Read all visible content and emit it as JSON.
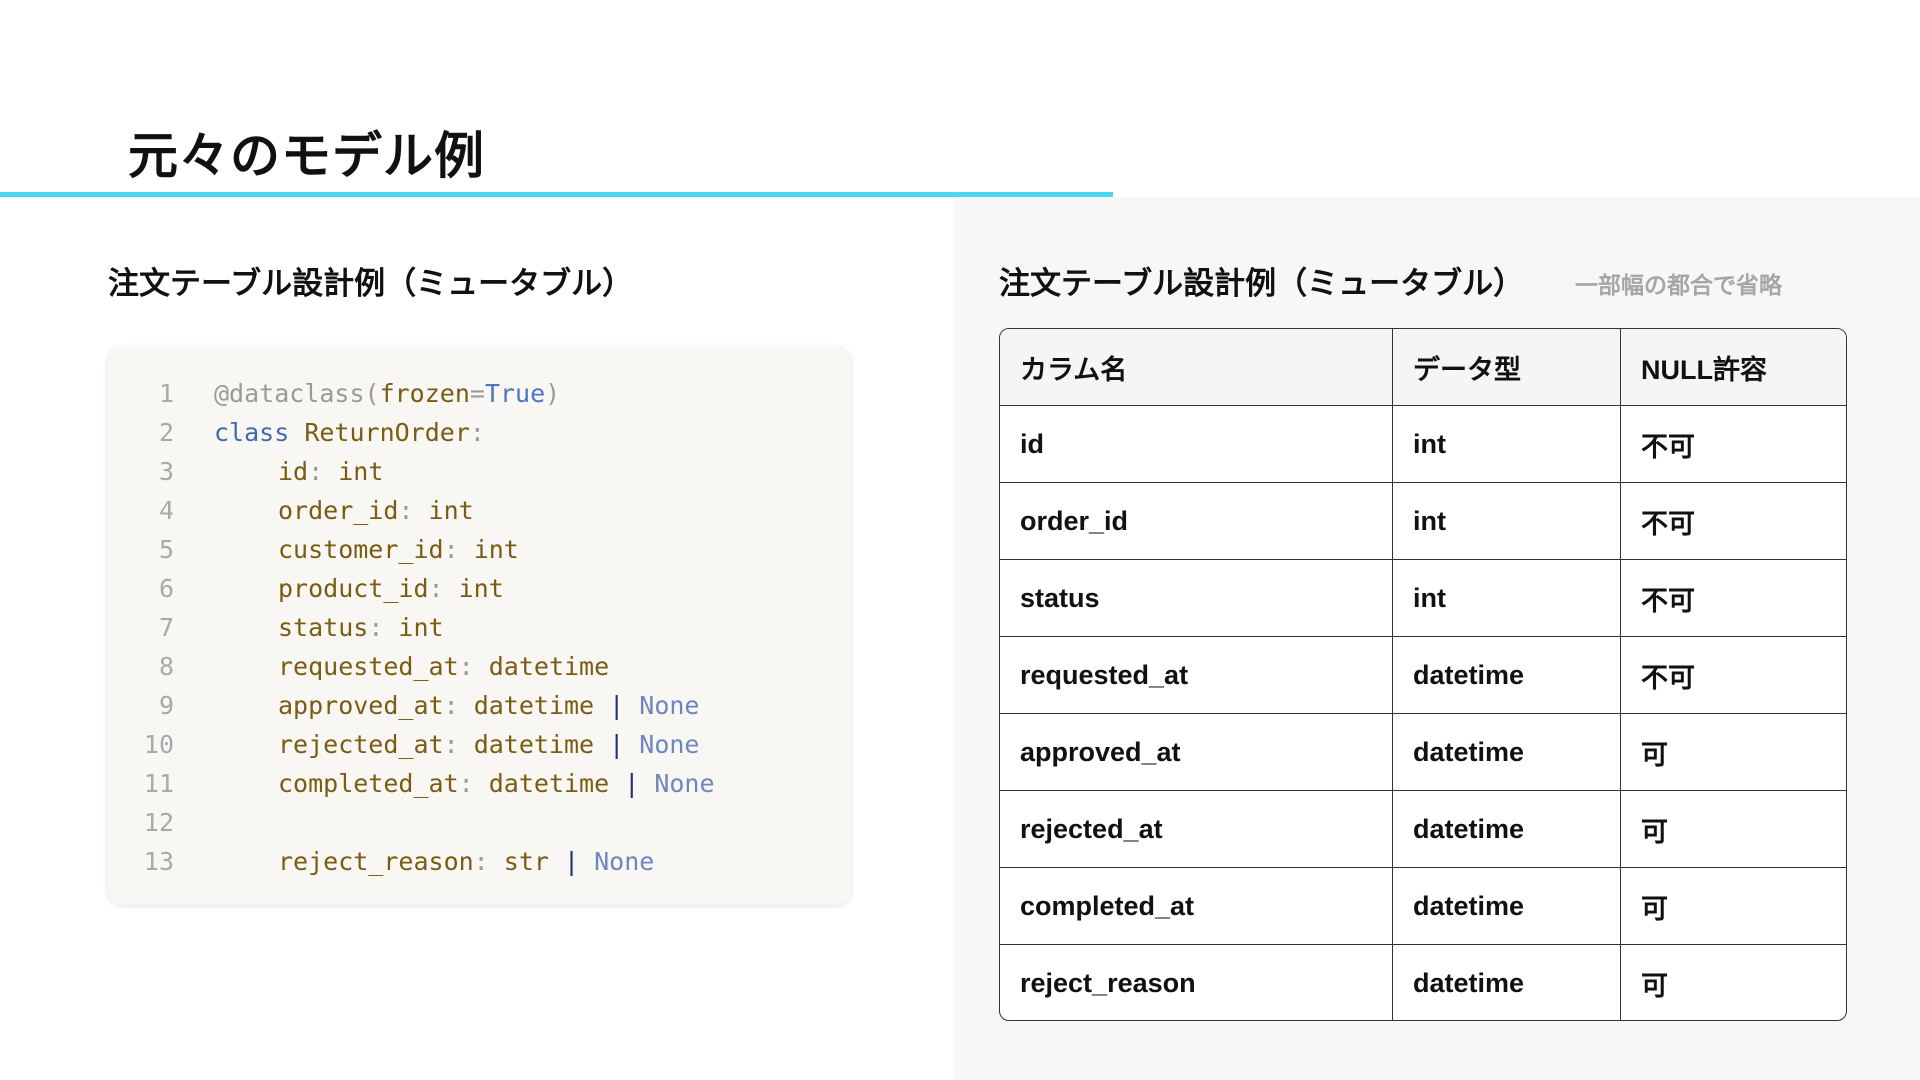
{
  "slide": {
    "title": "元々のモデル例",
    "accent_color": "#4dd6ef"
  },
  "left_section": {
    "heading": "注文テーブル設計例（ミュータブル）"
  },
  "code": {
    "lines": [
      {
        "n": "1",
        "indent": 0,
        "tokens": [
          [
            "deco",
            "@dataclass("
          ],
          [
            "name",
            "frozen"
          ],
          [
            "punct",
            "="
          ],
          [
            "true",
            "True"
          ],
          [
            "deco",
            ")"
          ]
        ]
      },
      {
        "n": "2",
        "indent": 0,
        "tokens": [
          [
            "kw",
            "class "
          ],
          [
            "name",
            "ReturnOrder"
          ],
          [
            "punct",
            ":"
          ]
        ]
      },
      {
        "n": "3",
        "indent": 1,
        "tokens": [
          [
            "name",
            "id"
          ],
          [
            "punct",
            ": "
          ],
          [
            "name",
            "int"
          ]
        ]
      },
      {
        "n": "4",
        "indent": 1,
        "tokens": [
          [
            "name",
            "order_id"
          ],
          [
            "punct",
            ": "
          ],
          [
            "name",
            "int"
          ]
        ]
      },
      {
        "n": "5",
        "indent": 1,
        "tokens": [
          [
            "name",
            "customer_id"
          ],
          [
            "punct",
            ": "
          ],
          [
            "name",
            "int"
          ]
        ]
      },
      {
        "n": "6",
        "indent": 1,
        "tokens": [
          [
            "name",
            "product_id"
          ],
          [
            "punct",
            ": "
          ],
          [
            "name",
            "int"
          ]
        ]
      },
      {
        "n": "7",
        "indent": 1,
        "tokens": [
          [
            "name",
            "status"
          ],
          [
            "punct",
            ": "
          ],
          [
            "name",
            "int"
          ]
        ]
      },
      {
        "n": "8",
        "indent": 1,
        "tokens": [
          [
            "name",
            "requested_at"
          ],
          [
            "punct",
            ": "
          ],
          [
            "name",
            "datetime"
          ]
        ]
      },
      {
        "n": "9",
        "indent": 1,
        "tokens": [
          [
            "name",
            "approved_at"
          ],
          [
            "punct",
            ": "
          ],
          [
            "name",
            "datetime "
          ],
          [
            "pipe",
            "| "
          ],
          [
            "none",
            "None"
          ]
        ]
      },
      {
        "n": "10",
        "indent": 1,
        "tokens": [
          [
            "name",
            "rejected_at"
          ],
          [
            "punct",
            ": "
          ],
          [
            "name",
            "datetime "
          ],
          [
            "pipe",
            "| "
          ],
          [
            "none",
            "None"
          ]
        ]
      },
      {
        "n": "11",
        "indent": 1,
        "tokens": [
          [
            "name",
            "completed_at"
          ],
          [
            "punct",
            ": "
          ],
          [
            "name",
            "datetime "
          ],
          [
            "pipe",
            "| "
          ],
          [
            "none",
            "None"
          ]
        ]
      },
      {
        "n": "12",
        "indent": 0,
        "tokens": []
      },
      {
        "n": "13",
        "indent": 1,
        "tokens": [
          [
            "name",
            "reject_reason"
          ],
          [
            "punct",
            ": "
          ],
          [
            "name",
            "str "
          ],
          [
            "pipe",
            "| "
          ],
          [
            "none",
            "None"
          ]
        ]
      }
    ]
  },
  "right_section": {
    "heading": "注文テーブル設計例（ミュータブル）",
    "note": "一部幅の都合で省略"
  },
  "table": {
    "headers": [
      "カラム名",
      "データ型",
      "NULL許容"
    ],
    "rows": [
      [
        "id",
        "int",
        "不可"
      ],
      [
        "order_id",
        "int",
        "不可"
      ],
      [
        "status",
        "int",
        "不可"
      ],
      [
        "requested_at",
        "datetime",
        "不可"
      ],
      [
        "approved_at",
        "datetime",
        "可"
      ],
      [
        "rejected_at",
        "datetime",
        "可"
      ],
      [
        "completed_at",
        "datetime",
        "可"
      ],
      [
        "reject_reason",
        "datetime",
        "可"
      ]
    ]
  }
}
